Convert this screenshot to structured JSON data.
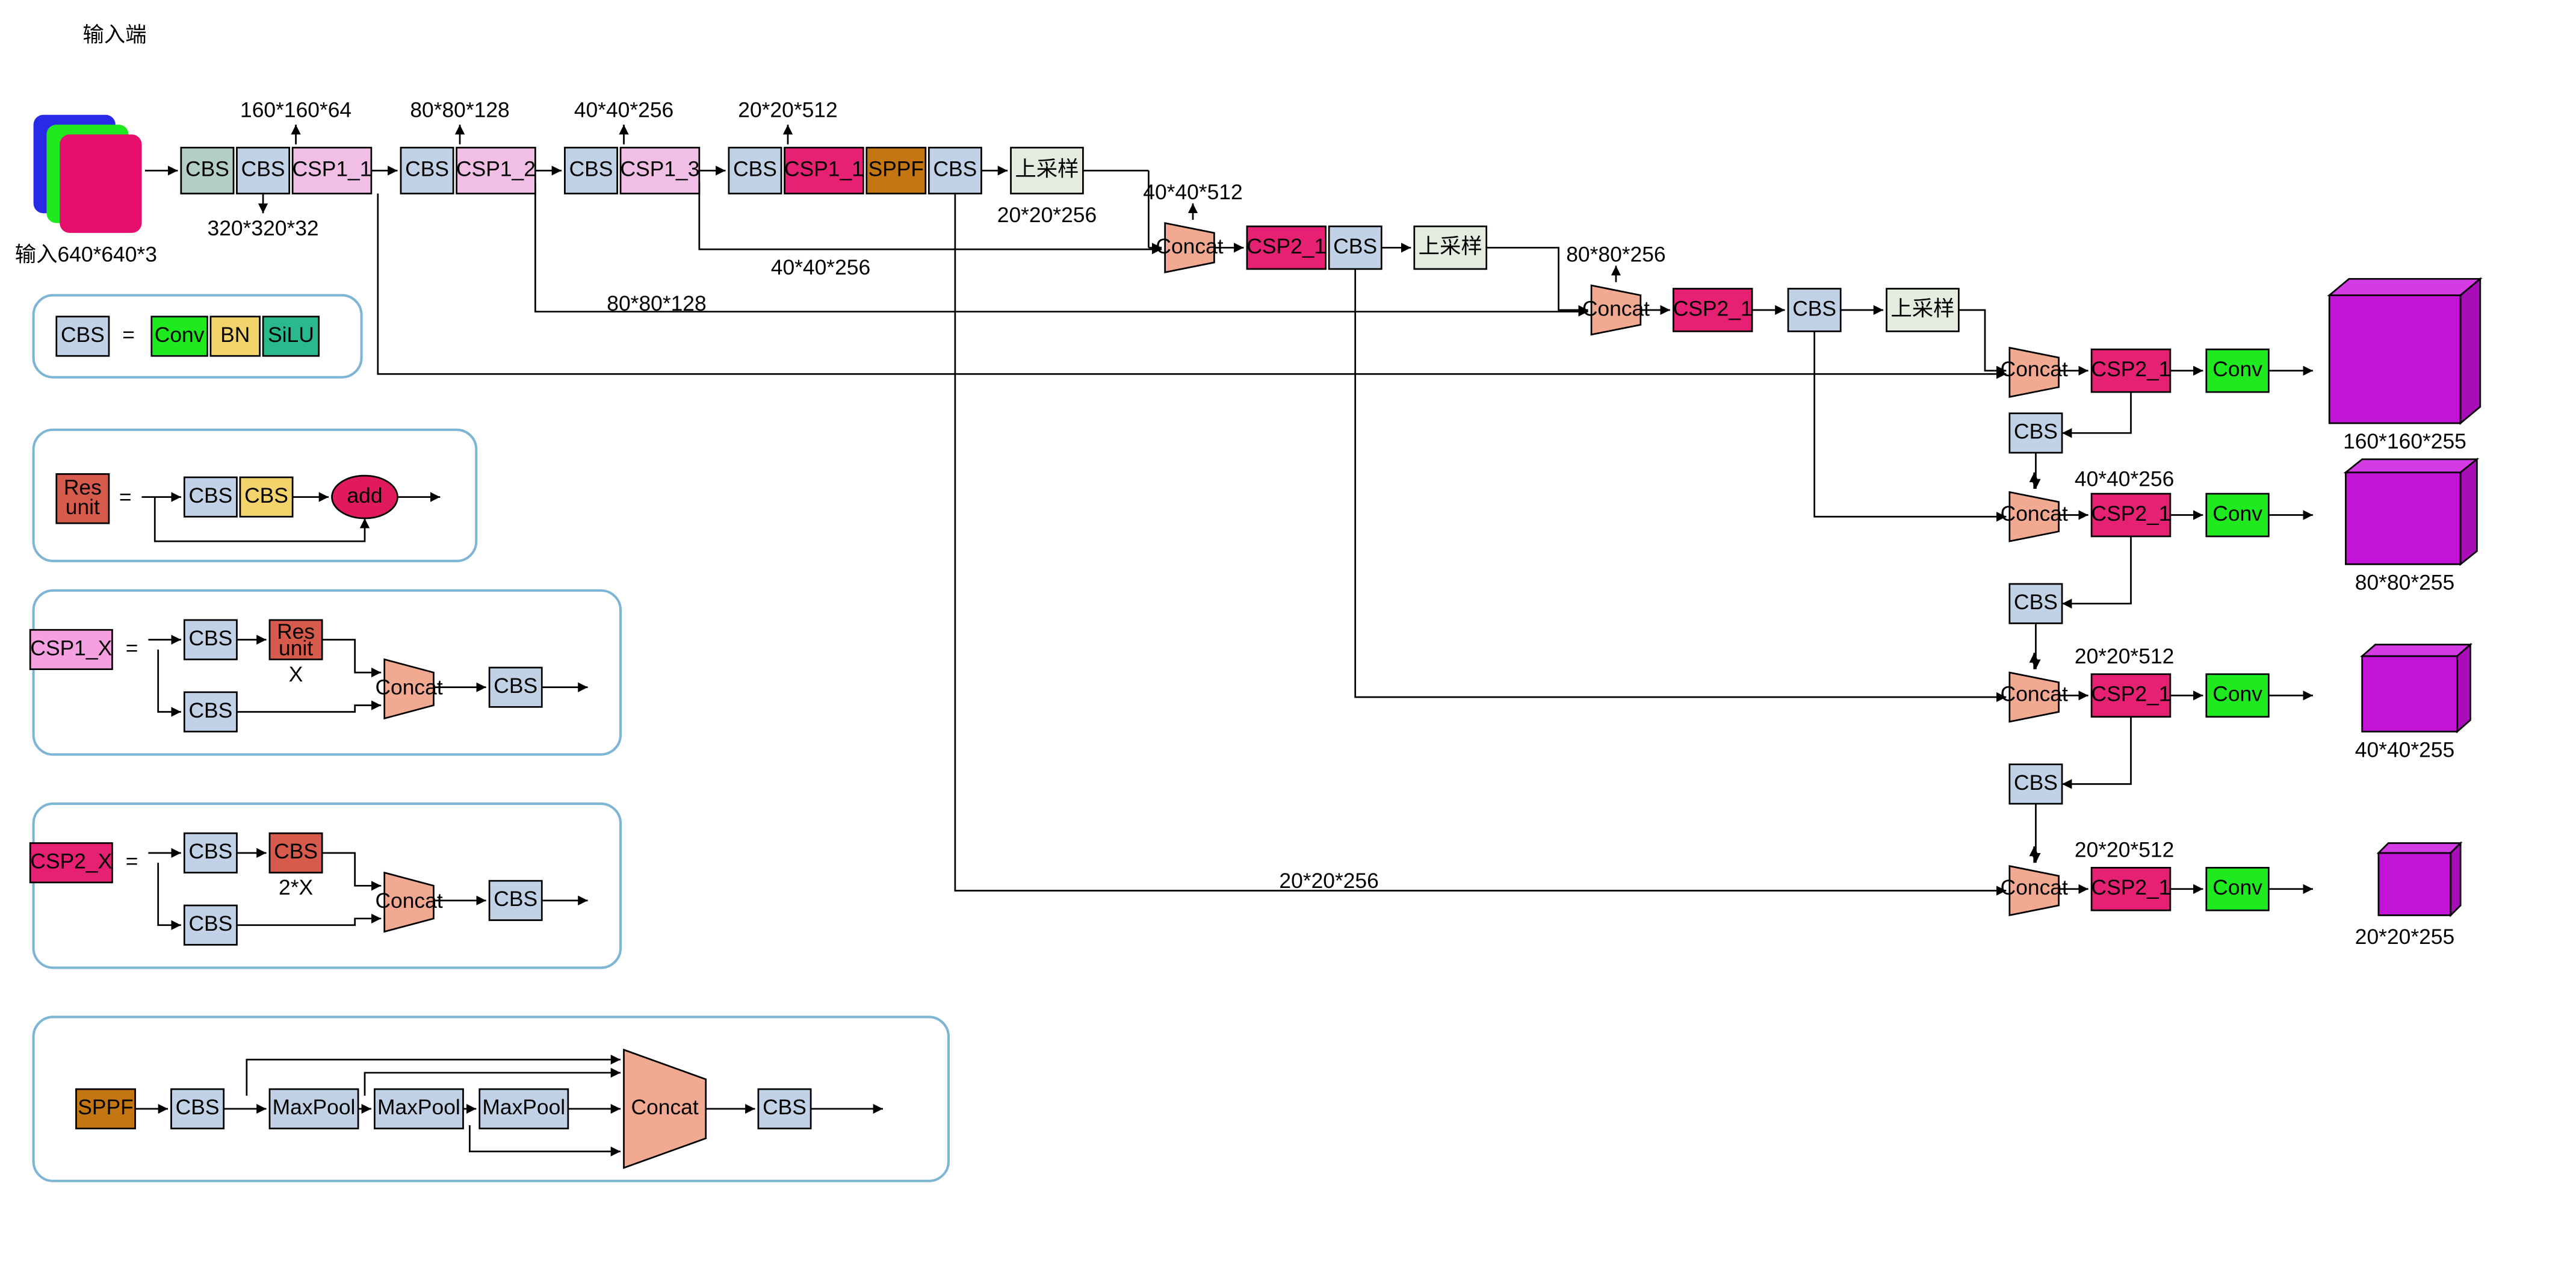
{
  "title": "输入端",
  "colors": {
    "cbs_teal": "#b3cec5",
    "cbs_blue": "#c1d2e6",
    "csp1_pink": "#f1bfe6",
    "csp1_red": "#e62174",
    "csp2_red": "#e62174",
    "sppf": "#c47612",
    "upsample": "#e3ecde",
    "concat": "#f2a992",
    "conv_green": "#1fea1f",
    "bn_yellow": "#f3d36b",
    "silu_green": "#29b98c",
    "resunit": "#d75b4c",
    "add": "#e11a5f",
    "csp1x_pink": "#f5a1e1",
    "cube_fill": "#c313d6",
    "cube_side": "#a90db8",
    "cube_top": "#d43be4",
    "input_blue": "#2929e8",
    "input_green": "#1fea1f",
    "input_magenta": "#e60e6d"
  },
  "labels": {
    "input_dim": "输入640*640*3",
    "cbs": "CBS",
    "csp1_1": "CSP1_1",
    "csp1_2": "CSP1_2",
    "csp1_3": "CSP1_3",
    "csp1_1b": "CSP1_1",
    "sppf": "SPPF",
    "upsample": "上采样",
    "concat": "Concat",
    "csp2_1": "CSP2_1",
    "conv": "Conv",
    "bn": "BN",
    "silu": "SiLU",
    "resunit": "Res\nunit",
    "add": "add",
    "csp1x": "CSP1_X",
    "csp2x": "CSP2_X",
    "maxpool": "MaxPool",
    "x_label": "X",
    "x2_label": "2*X"
  },
  "dims": {
    "d1": "320*320*32",
    "d2": "160*160*64",
    "d3": "80*80*128",
    "d4": "40*40*256",
    "d5": "20*20*512",
    "d6": "20*20*256",
    "d7": "40*40*256",
    "d8": "80*80*128",
    "d9": "40*40*512",
    "d10": "80*80*256",
    "d11": "40*40*256",
    "d12": "20*20*512",
    "d13b": "20*20*512",
    "d_mid": "20*20*256",
    "out1": "160*160*255",
    "out2": "80*80*255",
    "out3": "40*40*255",
    "out4": "20*20*255"
  }
}
